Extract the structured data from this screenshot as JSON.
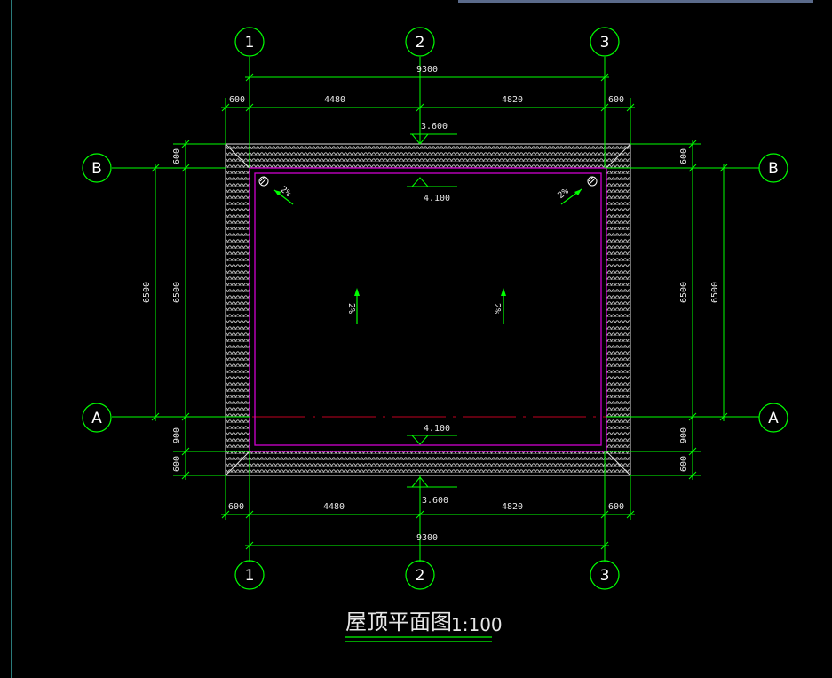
{
  "colors": {
    "background": "#000000",
    "dim_line": "#00ff00",
    "text": "#e6e6e6",
    "parapet": "#d000d0",
    "axis_dashed": "#c00020",
    "tile": "#c8c8c8"
  },
  "grid_axes": {
    "vertical": [
      "1",
      "2",
      "3"
    ],
    "horizontal": [
      "B",
      "A"
    ]
  },
  "dimensions": {
    "top_total": "9300",
    "top_segments": [
      "600",
      "4480",
      "4820",
      "600"
    ],
    "bottom_total": "9300",
    "bottom_segments": [
      "600",
      "4480",
      "4820",
      "600"
    ],
    "left_outer": "6500",
    "left_inner": "6500",
    "left_segments": [
      "600",
      "900",
      "600"
    ],
    "right_outer": "6500",
    "right_inner": "6500",
    "right_segments": [
      "600",
      "900",
      "600"
    ]
  },
  "elevations": {
    "top_eave": "3.600",
    "top_parapet": "4.100",
    "bottom_parapet": "4.100",
    "bottom_eave": "3.600"
  },
  "slopes": [
    "2%",
    "2%",
    "2%",
    "2%"
  ],
  "drain_icon": "roof-drain-icon",
  "title": {
    "main": "屋顶平面图",
    "scale": "1:100"
  }
}
